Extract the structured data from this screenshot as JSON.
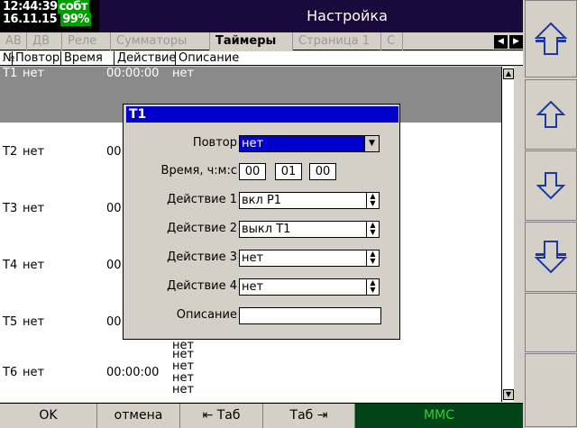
{
  "status": {
    "time": "12:44:39",
    "event": "собт",
    "date": "16.11.15",
    "battery": "99%"
  },
  "title": "Настройка",
  "tabs": [
    {
      "label": "АВ",
      "active": false
    },
    {
      "label": "ДВ",
      "active": false
    },
    {
      "label": "Реле",
      "active": false
    },
    {
      "label": "Сумматоры",
      "active": false
    },
    {
      "label": "Таймеры",
      "active": true
    },
    {
      "label": "Страница 1",
      "active": false
    },
    {
      "label": "С",
      "active": false
    }
  ],
  "tab_arrows": {
    "left": "◀",
    "right": "▶"
  },
  "table": {
    "headers": {
      "num": "№",
      "repeat": "Повтор",
      "time": "Время",
      "action": "Действие",
      "desc": "Описание"
    },
    "rows": [
      {
        "num": "T1",
        "repeat": "нет",
        "time": "00:00:00",
        "actions": [
          "нет"
        ]
      },
      {
        "num": "T2",
        "repeat": "нет",
        "time": "00",
        "actions": []
      },
      {
        "num": "T3",
        "repeat": "нет",
        "time": "00",
        "actions": []
      },
      {
        "num": "T4",
        "repeat": "нет",
        "time": "00",
        "actions": []
      },
      {
        "num": "T5",
        "repeat": "нет",
        "time": "00",
        "actions": []
      },
      {
        "num": "T6",
        "repeat": "нет",
        "time": "00:00:00",
        "actions": [
          "нет",
          "нет",
          "нет",
          "нет"
        ]
      }
    ],
    "t5_extra_actions": [
      "нет"
    ]
  },
  "dialog": {
    "title": "T1",
    "repeat_label": "Повтор",
    "repeat_value": "нет",
    "time_label": "Время, ч:м:с",
    "time_h": "00",
    "time_m": "01",
    "time_s": "00",
    "action1_label": "Действие 1",
    "action1_value": "вкл Р1",
    "action2_label": "Действие 2",
    "action2_value": "выкл T1",
    "action3_label": "Действие 3",
    "action3_value": "нет",
    "action4_label": "Действие 4",
    "action4_value": "нет",
    "desc_label": "Описание",
    "desc_value": ""
  },
  "bottom": {
    "ok": "OK",
    "cancel": "отмена",
    "prev_tab": "⇤ Таб",
    "next_tab": "Таб ⇥",
    "mmc": "MMC"
  },
  "nav_icons": [
    "double-up-arrow-icon",
    "up-arrow-icon",
    "down-arrow-icon",
    "double-down-arrow-icon"
  ],
  "colors": {
    "title_bg": "#1a0a3c",
    "dialog_title": "#0000cc",
    "selected_row": "#8a8a8a",
    "mmc_bg": "#004418",
    "mmc_text": "#3ccc3c"
  }
}
